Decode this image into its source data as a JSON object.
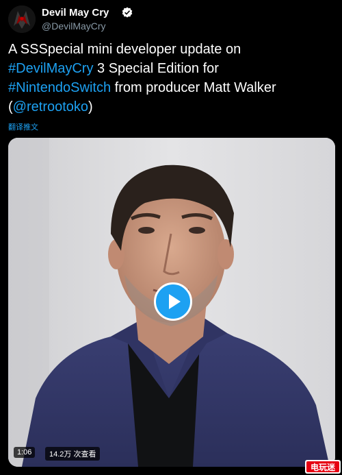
{
  "author": {
    "name": "Devil May Cry",
    "handle": "@DevilMayCry",
    "avatar_icon": "devil-may-cry-logo",
    "verified_icon": "verified-badge-icon"
  },
  "tweet": {
    "line1": "A SSSpecial mini developer update on",
    "hashtag1": "#DevilMayCry",
    "line2_rest": " 3 Special Edition for",
    "hashtag2": "#NintendoSwitch",
    "line3_rest": " from producer Matt Walker",
    "mention_open": "(",
    "mention": "@retrootoko",
    "mention_close": ")",
    "translate_label": "翻译推文"
  },
  "video": {
    "duration": "1:06",
    "views": "14.2万 次查看",
    "play_icon": "play-icon"
  },
  "watermark": {
    "text": "电玩迷"
  },
  "colors": {
    "background": "#000000",
    "link": "#1da1f2",
    "secondary_text": "#8899a6"
  }
}
